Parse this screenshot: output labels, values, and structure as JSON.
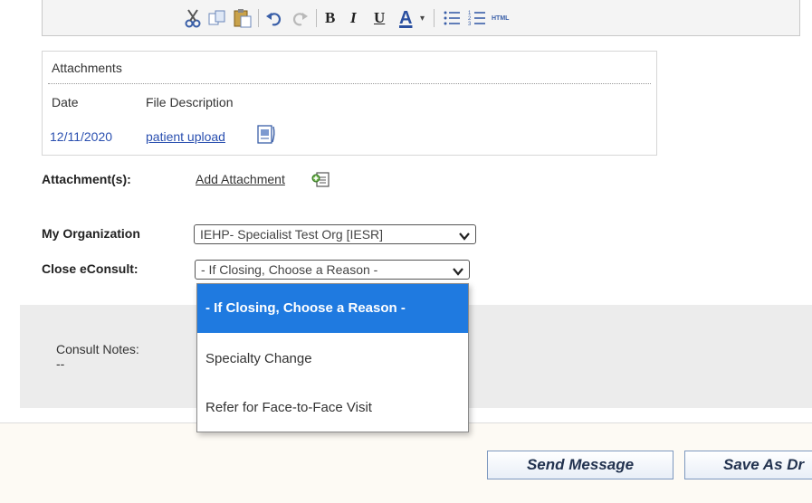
{
  "toolbar": {
    "icons": [
      "cut-icon",
      "copy-icon",
      "paste-icon",
      "undo-icon",
      "redo-icon",
      "bold-icon",
      "italic-icon",
      "underline-icon",
      "font-color-icon",
      "bullet-list-icon",
      "numbered-list-icon",
      "html-icon"
    ],
    "bold": "B",
    "italic": "I",
    "underline": "U",
    "font_color": "A",
    "html": "HTML"
  },
  "attachments": {
    "title": "Attachments",
    "col_date": "Date",
    "col_desc": "File Description",
    "rows": [
      {
        "date": "12/11/2020",
        "file": "patient upload"
      }
    ]
  },
  "form": {
    "attachments_label": "Attachment(s):",
    "add_attachment": "Add Attachment",
    "org_label": "My Organization",
    "org_value": "IEHP- Specialist Test Org [IESR]",
    "close_label": "Close eConsult:",
    "close_value": "- If Closing, Choose a Reason -"
  },
  "dropdown": {
    "options": [
      "- If Closing, Choose a Reason -",
      "Specialty Change",
      "Refer for Face-to-Face Visit"
    ],
    "selected_index": 0
  },
  "notes": {
    "label": "Consult Notes:",
    "value": "--"
  },
  "buttons": {
    "send": "Send Message",
    "save_draft": "Save As Dr"
  },
  "colors": {
    "link": "#2b50b0",
    "selected_option": "#1f7ae0",
    "panel": "#ececec"
  }
}
